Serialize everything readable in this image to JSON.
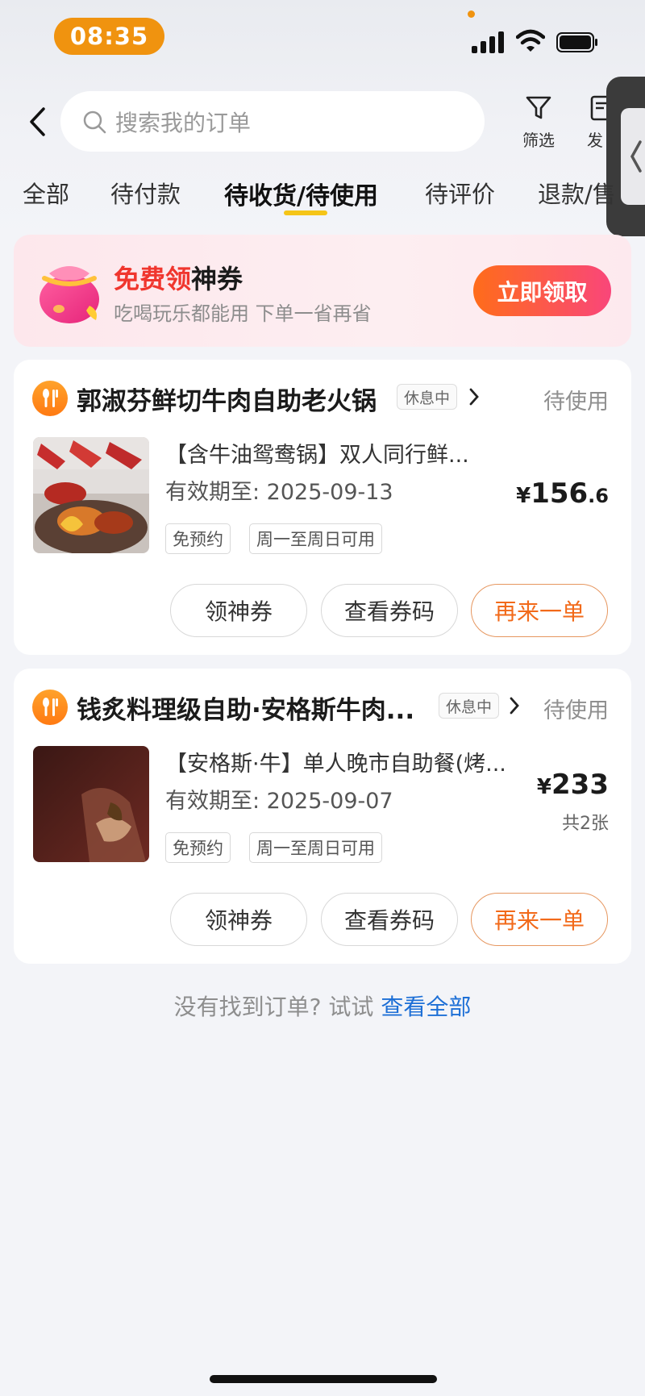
{
  "status_bar": {
    "time": "08:35"
  },
  "search": {
    "placeholder": "搜索我的订单"
  },
  "header_actions": {
    "filter_label": "筛选",
    "invoice_label": "发"
  },
  "tabs": [
    {
      "label": "全部",
      "active": false
    },
    {
      "label": "待付款",
      "active": false
    },
    {
      "label": "待收货/待使用",
      "active": true
    },
    {
      "label": "待评价",
      "active": false
    },
    {
      "label": "退款/售",
      "active": false
    }
  ],
  "banner": {
    "title_highlight": "免费领",
    "title_rest": "神券",
    "subtitle": "吃喝玩乐都能用 下单一省再省",
    "button": "立即领取"
  },
  "orders": [
    {
      "shop_name": "郭淑芬鲜切牛肉自助老火锅",
      "badge": "休息中",
      "status": "待使用",
      "deal_title": "【含牛油鸳鸯锅】双人同行鲜...",
      "valid_until": "有效期至: 2025-09-13",
      "tags": [
        "免预约",
        "周一至周日可用"
      ],
      "price_symbol": "¥",
      "price_int": "156",
      "price_dec": ".6",
      "count": "",
      "buttons": [
        "领神券",
        "查看券码",
        "再来一单"
      ]
    },
    {
      "shop_name": "钱炙料理级自助·安格斯牛肉...",
      "badge": "休息中",
      "status": "待使用",
      "deal_title": "【安格斯·牛】单人晚市自助餐(烤...",
      "valid_until": "有效期至: 2025-09-07",
      "tags": [
        "免预约",
        "周一至周日可用"
      ],
      "price_symbol": "¥",
      "price_int": "233",
      "price_dec": "",
      "count": "共2张",
      "buttons": [
        "领神券",
        "查看券码",
        "再来一单"
      ]
    }
  ],
  "footer": {
    "tip": "没有找到订单? 试试 ",
    "link": "查看全部"
  },
  "colors": {
    "accent_orange": "#f26a1a",
    "tab_underline": "#f5c518",
    "link_blue": "#1d6fd6",
    "status_pill": "#f0930f"
  }
}
